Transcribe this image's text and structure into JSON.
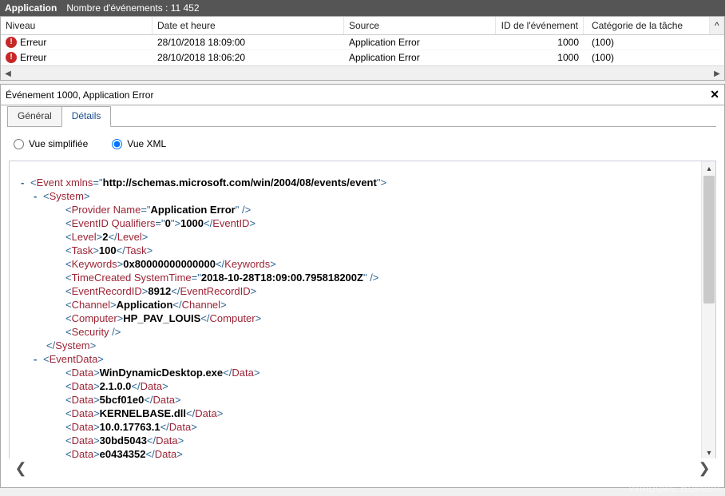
{
  "topbar": {
    "appname": "Application",
    "count_label": "Nombre d'événements : 11 452"
  },
  "grid": {
    "headers": {
      "niveau": "Niveau",
      "date": "Date et heure",
      "source": "Source",
      "id": "ID de l'événement",
      "cat": "Catégorie de la tâche"
    },
    "rows": [
      {
        "niveau": "Erreur",
        "date": "28/10/2018 18:09:00",
        "source": "Application Error",
        "id": "1000",
        "cat": "(100)"
      },
      {
        "niveau": "Erreur",
        "date": "28/10/2018 18:06:20",
        "source": "Application Error",
        "id": "1000",
        "cat": "(100)"
      }
    ]
  },
  "pane": {
    "title": "Événement 1000, Application Error"
  },
  "tabs": {
    "general": "Général",
    "details": "Détails"
  },
  "radios": {
    "simple": "Vue simplifiée",
    "xml": "Vue XML"
  },
  "xml": {
    "xmlns": "http://schemas.microsoft.com/win/2004/08/events/event",
    "providerName": "Application Error",
    "eventIdQualifiers": "0",
    "eventId": "1000",
    "level": "2",
    "task": "100",
    "keywords": "0x80000000000000",
    "systemTime": "2018-10-28T18:09:00.795818200Z",
    "eventRecordId": "8912",
    "channel": "Application",
    "computer": "HP_PAV_LOUIS",
    "data": [
      "WinDynamicDesktop.exe",
      "2.1.0.0",
      "5bcf01e0",
      "KERNELBASE.dll",
      "10.0.17763.1",
      "30bd5043",
      "e0434352"
    ]
  },
  "watermark": "Windows Bulletin"
}
